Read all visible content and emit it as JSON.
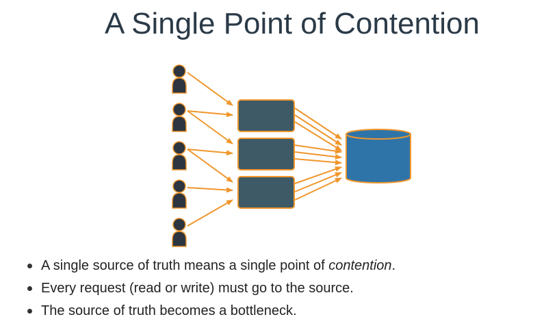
{
  "title": "A Single Point of Contention",
  "colors": {
    "arrow": "#f0962c",
    "person": "#2d3640",
    "server_fill": "#3d5a66",
    "server_border": "#f0962c",
    "database_fill": "#2f74a8",
    "database_border": "#f0962c"
  },
  "diagram": {
    "icons": [
      "person-icon",
      "server-box-icon",
      "database-icon"
    ]
  },
  "bullets": [
    {
      "before": "A single source of truth means a single point of ",
      "emphasis": "contention",
      "after": "."
    },
    {
      "before": "Every request (read or write) must go to the source.",
      "emphasis": "",
      "after": ""
    },
    {
      "before": "The source of truth becomes a bottleneck.",
      "emphasis": "",
      "after": ""
    }
  ]
}
